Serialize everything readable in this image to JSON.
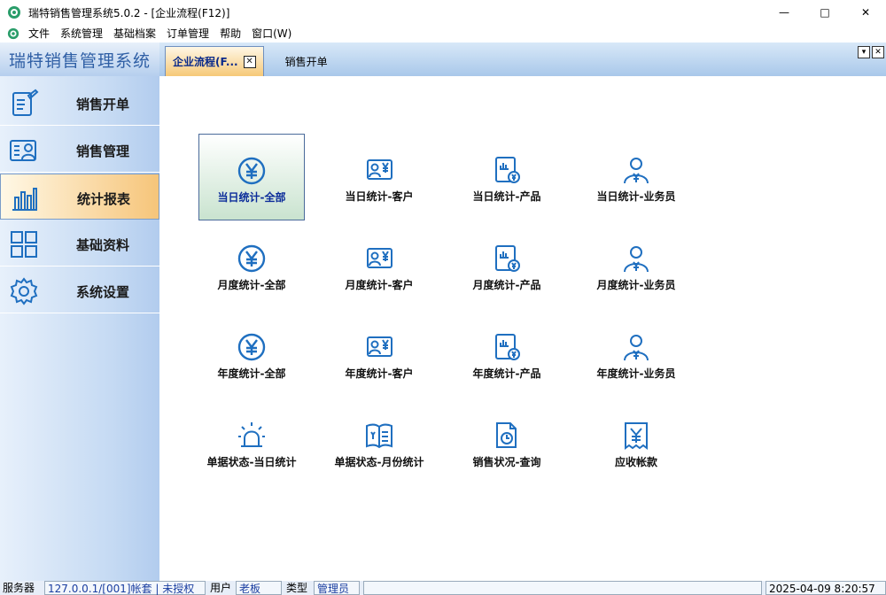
{
  "window": {
    "title": "瑞特销售管理系统5.0.2 - [企业流程(F12)]",
    "controls": [
      "—",
      "□",
      "✕"
    ]
  },
  "menu": {
    "items": [
      "文件",
      "系统管理",
      "基础档案",
      "订单管理",
      "帮助",
      "窗口(W)"
    ],
    "mdi_controls": [
      "_",
      "▫",
      "✕"
    ]
  },
  "header": {
    "logo": "瑞特销售管理系统",
    "tabs": [
      {
        "label": "企业流程(F...",
        "active": true,
        "close": "✕"
      },
      {
        "label": "销售开单",
        "active": false
      }
    ],
    "buttons": [
      "▾",
      "✕"
    ]
  },
  "sidebar": {
    "items": [
      {
        "label": "销售开单",
        "icon": "edit-document-icon",
        "active": false
      },
      {
        "label": "销售管理",
        "icon": "user-card-icon",
        "active": false
      },
      {
        "label": "统计报表",
        "icon": "bar-chart-icon",
        "active": true
      },
      {
        "label": "基础资料",
        "icon": "grid-icon",
        "active": false
      },
      {
        "label": "系统设置",
        "icon": "gear-icon",
        "active": false
      }
    ]
  },
  "main": {
    "tiles": [
      {
        "label": "当日统计-全部",
        "icon": "yen-circle-icon",
        "selected": true
      },
      {
        "label": "当日统计-客户",
        "icon": "customer-yen-icon"
      },
      {
        "label": "当日统计-产品",
        "icon": "product-report-icon"
      },
      {
        "label": "当日统计-业务员",
        "icon": "salesperson-icon"
      },
      {
        "label": "月度统计-全部",
        "icon": "yen-circle-icon"
      },
      {
        "label": "月度统计-客户",
        "icon": "customer-yen-icon"
      },
      {
        "label": "月度统计-产品",
        "icon": "product-report-icon"
      },
      {
        "label": "月度统计-业务员",
        "icon": "salesperson-icon"
      },
      {
        "label": "年度统计-全部",
        "icon": "yen-circle-icon"
      },
      {
        "label": "年度统计-客户",
        "icon": "customer-yen-icon"
      },
      {
        "label": "年度统计-产品",
        "icon": "product-report-icon"
      },
      {
        "label": "年度统计-业务员",
        "icon": "salesperson-icon"
      },
      {
        "label": "单据状态-当日统计",
        "icon": "alarm-light-icon"
      },
      {
        "label": "单据状态-月份统计",
        "icon": "ledger-book-icon"
      },
      {
        "label": "销售状况-查询",
        "icon": "document-clock-icon"
      },
      {
        "label": "应收帐款",
        "icon": "receipt-yen-icon"
      }
    ]
  },
  "statusbar": {
    "server_label": "服务器",
    "server_value": "127.0.0.1/[001]帐套 | 未授权",
    "user_label": "用户",
    "user_value": "老板",
    "type_label": "类型",
    "type_value": "管理员",
    "datetime": "2025-04-09 8:20:57"
  },
  "colors": {
    "accent": "#1f6fc0",
    "active_tab": "#f6c978",
    "header": "#a9c8ea"
  }
}
